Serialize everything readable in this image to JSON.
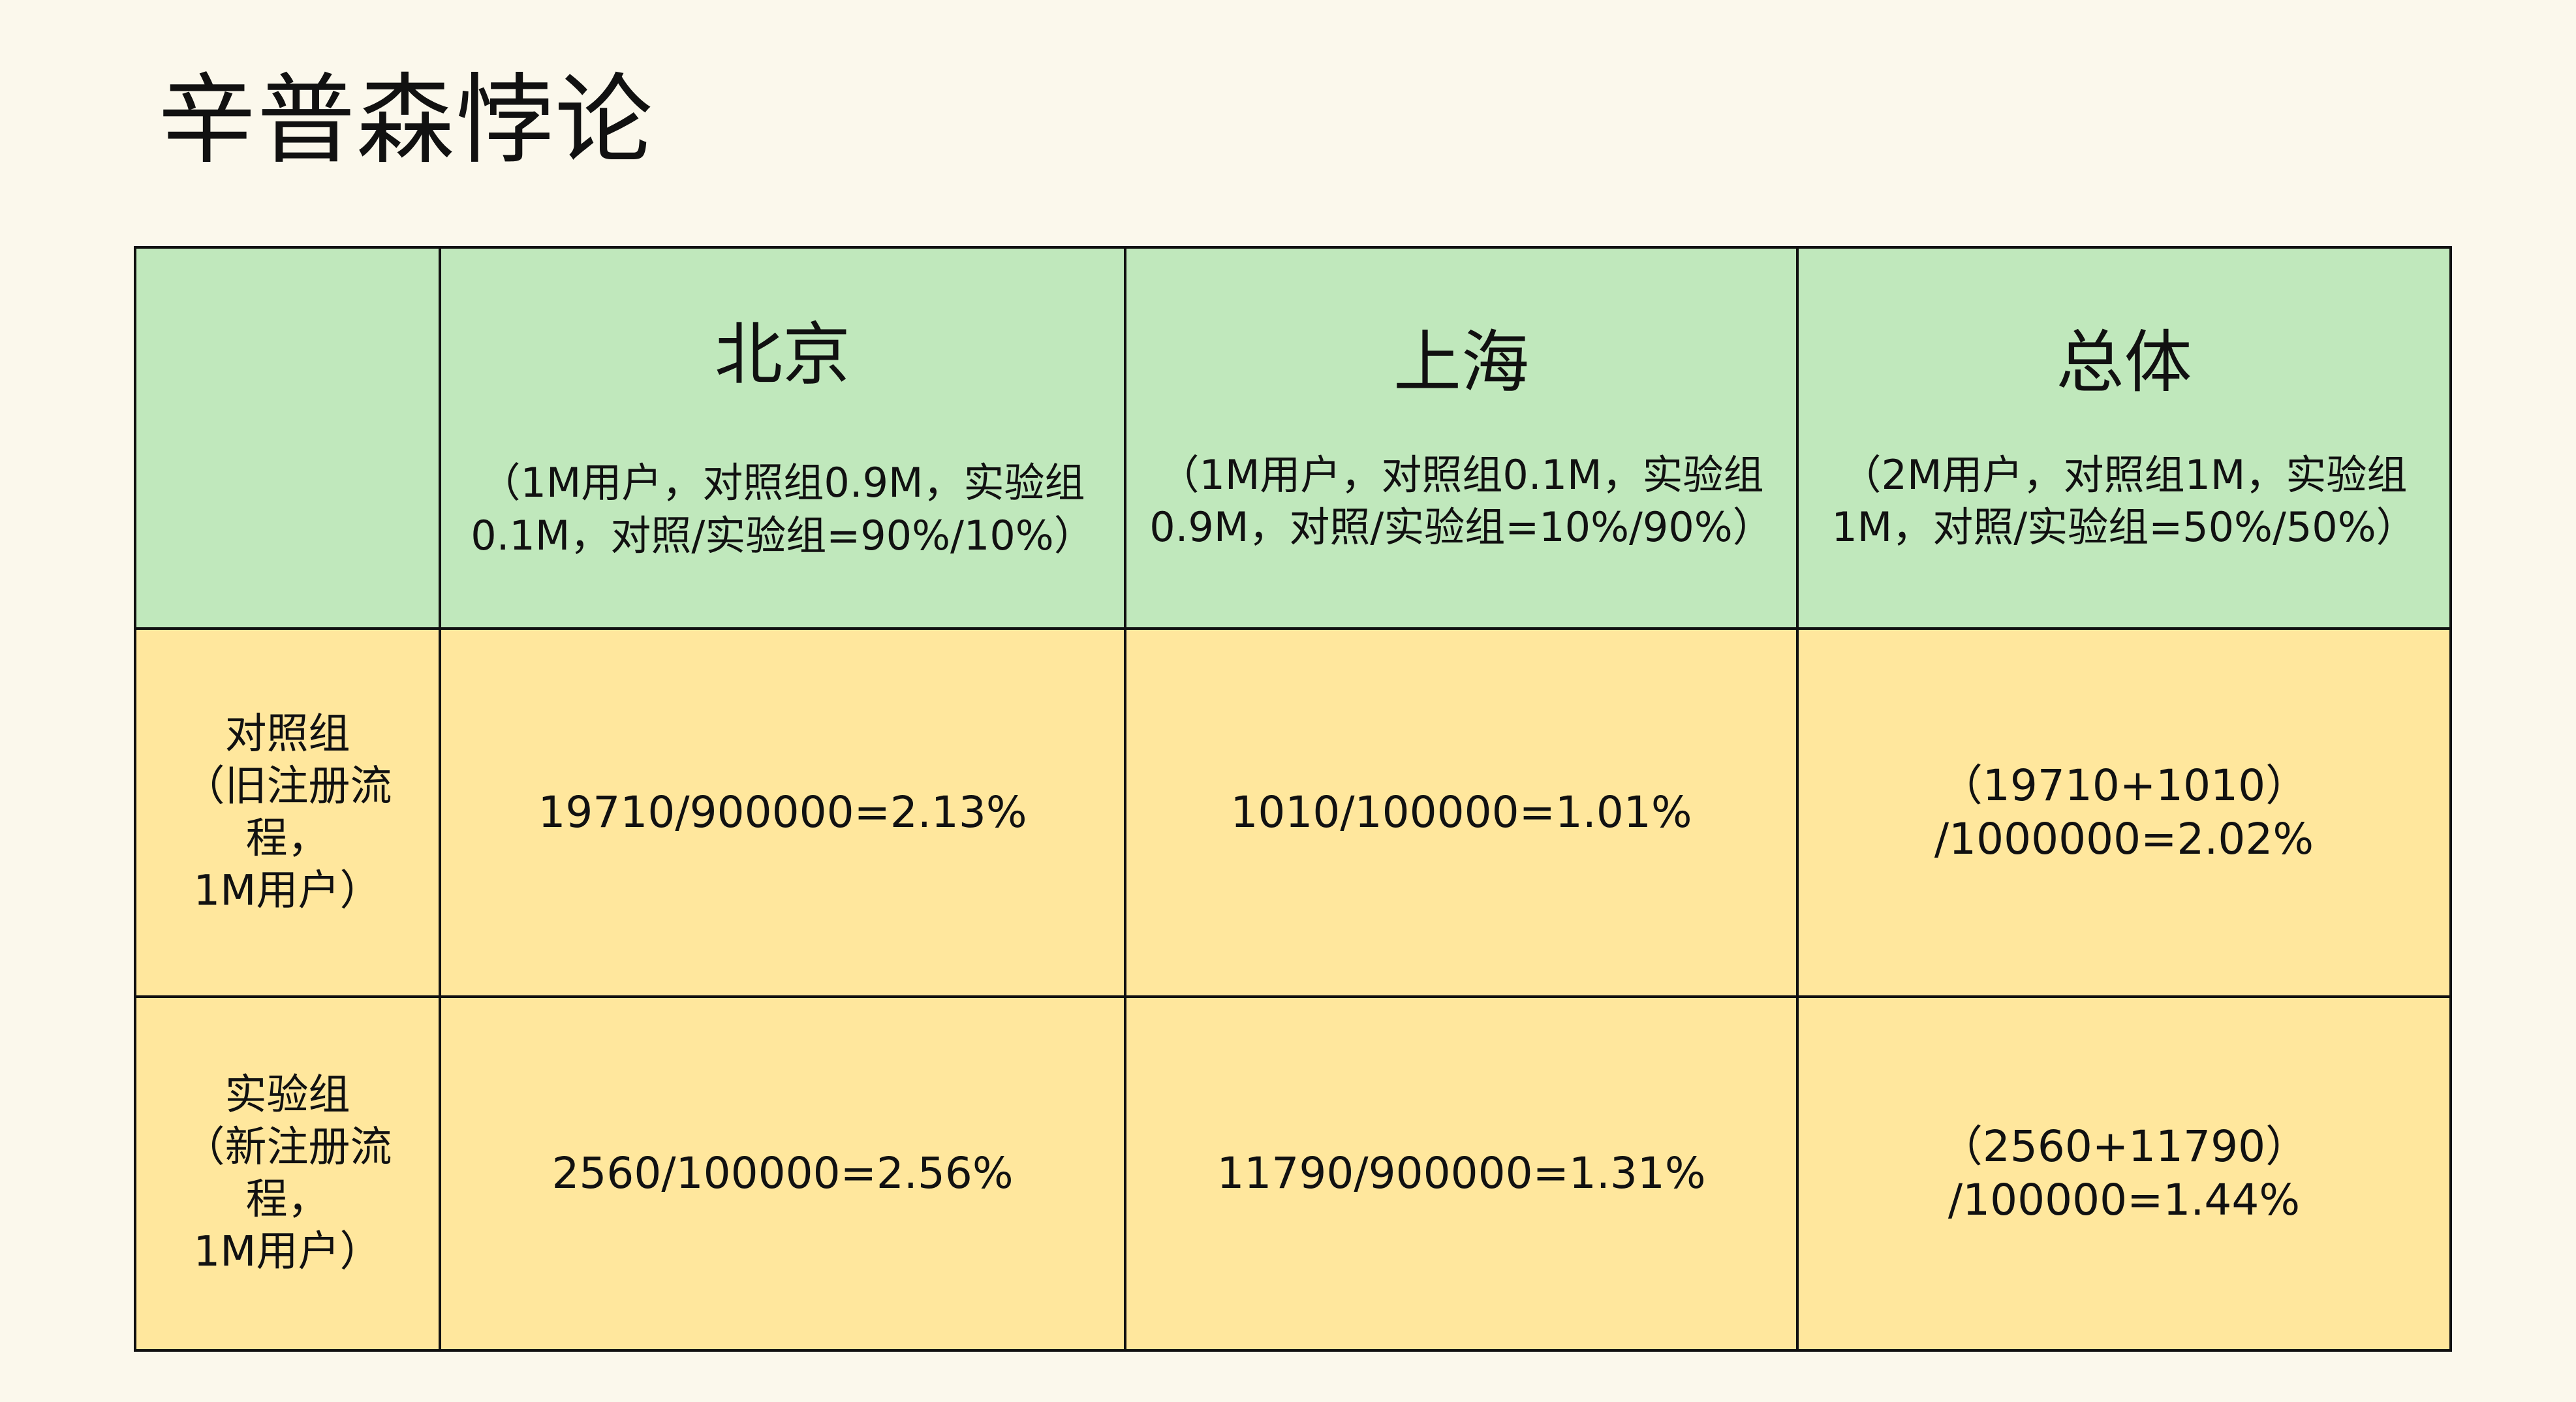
{
  "title": "辛普森悖论",
  "columns": [
    {
      "title": "北京",
      "subtitle": "（1M用户，对照组0.9M，实验组\n0.1M，对照/实验组=90%/10%）"
    },
    {
      "title": "上海",
      "subtitle": "（1M用户，对照组0.1M，实验组\n0.9M，对照/实验组=10%/90%）"
    },
    {
      "title": "总体",
      "subtitle": "（2M用户，对照组1M，实验组\n1M，对照/实验组=50%/50%）"
    }
  ],
  "rows": [
    {
      "label": "对照组\n（旧注册流程，\n1M用户）",
      "values": [
        "19710/900000=2.13%",
        "1010/100000=1.01%",
        "（19710+1010）\n/1000000=2.02%"
      ]
    },
    {
      "label": "实验组\n（新注册流程，\n1M用户）",
      "values": [
        "2560/100000=2.56%",
        "11790/900000=1.31%",
        "（2560+11790）\n/100000=1.44%"
      ]
    }
  ],
  "colors": {
    "background": "#fbf8ec",
    "header_fill": "#c0e8bc",
    "body_fill": "#ffe79d",
    "border": "#111111"
  }
}
